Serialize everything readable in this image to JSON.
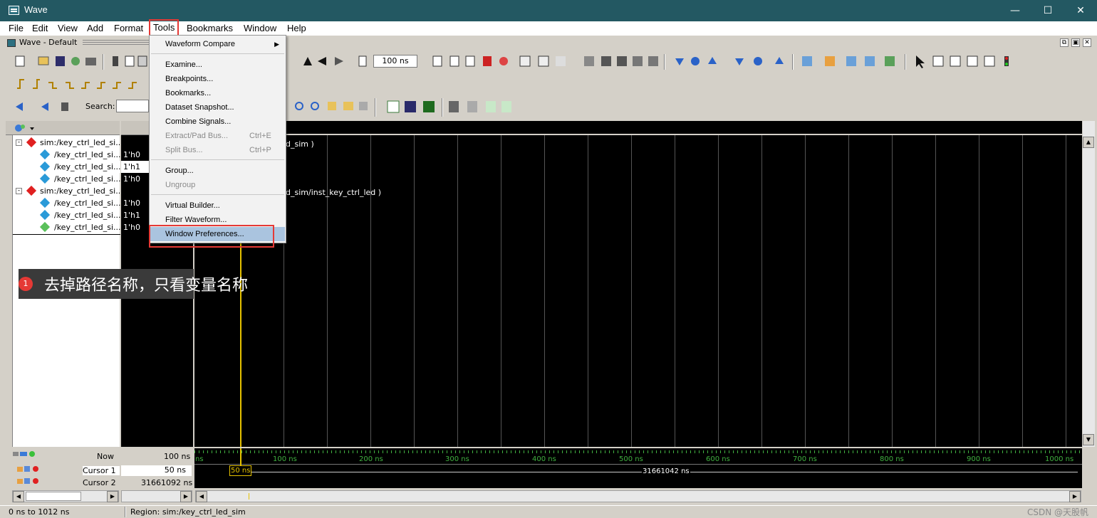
{
  "window": {
    "title": "Wave",
    "minimize": "—",
    "maximize": "☐",
    "close": "✕"
  },
  "menubar": [
    "File",
    "Edit",
    "View",
    "Add",
    "Format",
    "Tools",
    "Bookmarks",
    "Window",
    "Help"
  ],
  "subwindow": {
    "title": "Wave - Default"
  },
  "toolbar": {
    "time_value": "100 ns",
    "search_label": "Search:"
  },
  "signals": [
    {
      "name": "sim:/key_ctrl_led_si...",
      "value": "",
      "type": "group"
    },
    {
      "name": "/key_ctrl_led_si...",
      "value": "1'h0",
      "type": "signal"
    },
    {
      "name": "/key_ctrl_led_si...",
      "value": "1'h1",
      "type": "signal"
    },
    {
      "name": "/key_ctrl_led_si...",
      "value": "1'h0",
      "type": "signal"
    },
    {
      "name": "sim:/key_ctrl_led_si...",
      "value": "",
      "type": "group"
    },
    {
      "name": "/key_ctrl_led_si...",
      "value": "1'h0",
      "type": "signal"
    },
    {
      "name": "/key_ctrl_led_si...",
      "value": "1'h1",
      "type": "signal"
    },
    {
      "name": "/key_ctrl_led_si...",
      "value": "1'h0",
      "type": "signal"
    }
  ],
  "wave_labels": [
    "d_sim )",
    "d_sim/inst_key_ctrl_led )"
  ],
  "tools_menu": {
    "waveform_compare": "Waveform Compare",
    "examine": "Examine...",
    "breakpoints": "Breakpoints...",
    "bookmarks": "Bookmarks...",
    "dataset_snapshot": "Dataset Snapshot...",
    "combine_signals": "Combine Signals...",
    "extract_pad_bus": "Extract/Pad Bus...",
    "extract_shortcut": "Ctrl+E",
    "split_bus": "Split Bus...",
    "split_shortcut": "Ctrl+P",
    "group": "Group...",
    "ungroup": "Ungroup",
    "virtual_builder": "Virtual Builder...",
    "filter_waveform": "Filter Waveform...",
    "window_preferences": "Window Preferences..."
  },
  "annotation": {
    "badge": "1",
    "text": "去掉路径名称，只看变量名称"
  },
  "cursors": {
    "now_label": "Now",
    "now_value": "100 ns",
    "cursor1_label": "Cursor 1",
    "cursor1_value": "50 ns",
    "cursor2_label": "Cursor 2",
    "cursor2_value": "31661092 ns",
    "cursor1_marker": "50 ns",
    "delta": "31661042 ns"
  },
  "ruler": [
    "ns",
    "100 ns",
    "200 ns",
    "300 ns",
    "400 ns",
    "500 ns",
    "600 ns",
    "700 ns",
    "800 ns",
    "900 ns",
    "1000 ns"
  ],
  "status": {
    "range": "0 ns to 1012 ns",
    "region": "Region: sim:/key_ctrl_led_sim"
  },
  "watermark": "CSDN @天股帆",
  "colors": {
    "titlebar": "#235862",
    "menu_highlight": "#aac4df",
    "annotation_red": "#e53935",
    "cursor": "#e6c200",
    "ruler": "#40b040"
  }
}
